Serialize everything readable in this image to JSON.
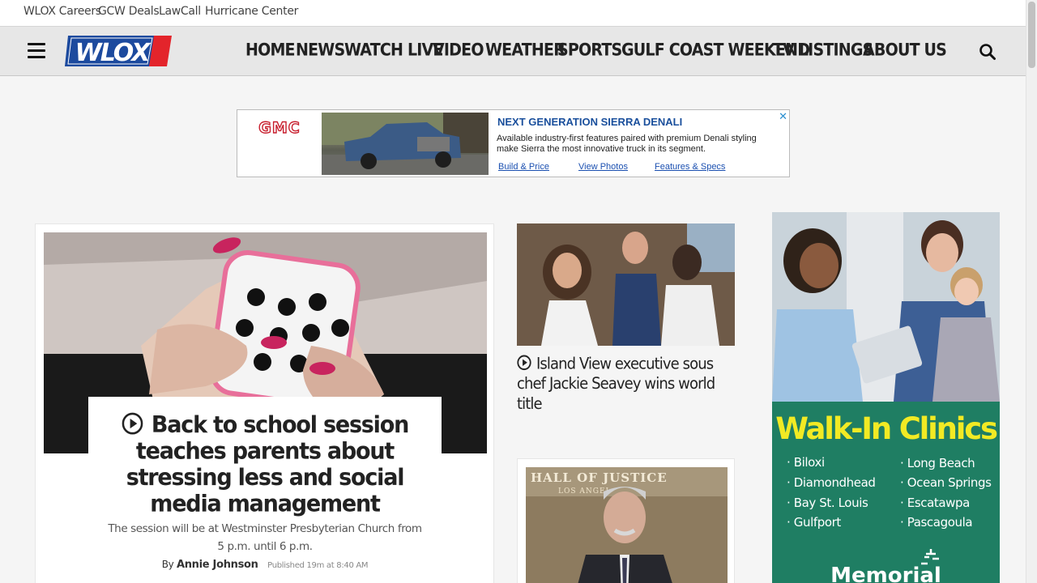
{
  "utility_links": [
    "WLOX Careers",
    "GCW Deals",
    "LawCall",
    "Hurricane Center"
  ],
  "nav": {
    "logo_text": "WLOX",
    "items": [
      "HOME",
      "NEWS",
      "WATCH LIVE",
      "VIDEO",
      "WEATHER",
      "SPORTS",
      "GULF COAST WEEKEND",
      "TV LISTINGS",
      "ABOUT US"
    ]
  },
  "ad_banner": {
    "brand": "GMC",
    "title": "NEXT GENERATION SIERRA DENALI",
    "body": "Available industry-first features paired with premium Denali styling make Sierra the most innovative truck in its segment.",
    "links": [
      "Build & Price",
      "View Photos",
      "Features & Specs"
    ],
    "close": "✕"
  },
  "lead_story": {
    "headline": "Back to school session teaches parents about stressing less and social media management",
    "deck": "The session will be at Westminster Presbyterian Church from 5 p.m. until 6 p.m.",
    "by": "By",
    "author": "Annie Johnson",
    "published": "Published 19m at 8:40 AM"
  },
  "story2": {
    "headline": "Island View executive sous chef Jackie Seavey wins world title"
  },
  "story3": {
    "image_text": "HALL OF JUSTICE",
    "image_subtext": "LOS ANGEL"
  },
  "side_ad": {
    "title": "Walk-In Clinics",
    "locations_left": [
      "Biloxi",
      "Diamondhead",
      "Bay St. Louis",
      "Gulfport"
    ],
    "locations_right": [
      "Long Beach",
      "Ocean Springs",
      "Escatawpa",
      "Pascagoula"
    ],
    "brand": "Memorial"
  }
}
